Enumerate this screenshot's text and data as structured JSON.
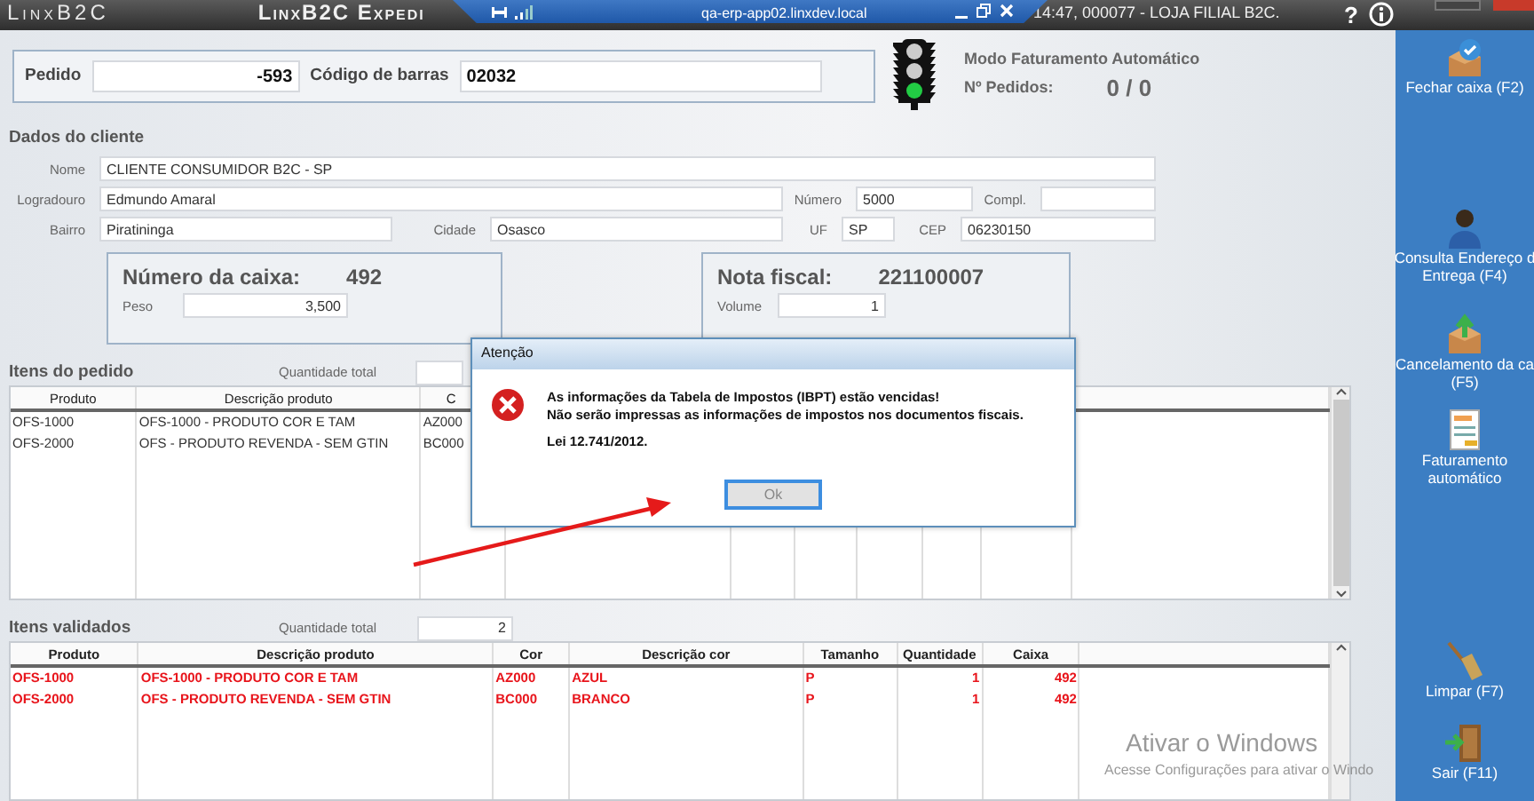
{
  "title_bar": {
    "app_name": "LinxB2C",
    "window_title": "LinxB2C Expedi",
    "session_info": "14:47, 000077 - LOJA FILIAL B2C.",
    "help": "?"
  },
  "remote_bar": {
    "host": "qa-erp-app02.linxdev.local"
  },
  "order": {
    "fields": [
      {
        "label": "Pedido",
        "value": "-593"
      },
      {
        "label": "Código de barras",
        "value": "02032"
      }
    ]
  },
  "status": {
    "mode_label": "Modo Faturamento Automático",
    "orders_label": "Nº Pedidos:",
    "orders_value": "0 / 0"
  },
  "customer": {
    "title": "Dados do cliente",
    "rows": [
      {
        "fields": [
          {
            "label": "Nome",
            "value": "CLIENTE CONSUMIDOR B2C - SP"
          }
        ]
      },
      {
        "fields": [
          {
            "label": "Logradouro",
            "value": "Edmundo Amaral"
          },
          {
            "label": "Número",
            "value": "5000"
          },
          {
            "label": "Compl."
          }
        ]
      },
      {
        "fields": [
          {
            "label": "Bairro",
            "value": "Piratininga"
          },
          {
            "label": "Cidade",
            "value": "Osasco"
          },
          {
            "label": "UF",
            "value": "SP"
          },
          {
            "label": "CEP",
            "value": "06230150"
          }
        ]
      }
    ]
  },
  "box": {
    "title": "Número da caixa:",
    "number": "492",
    "field": {
      "label": "Peso",
      "value": "3,500"
    }
  },
  "invoice": {
    "title": "Nota fiscal:",
    "number": "221100007",
    "field": {
      "label": "Volume",
      "value": "1"
    }
  },
  "order_items": {
    "title": "Itens do pedido",
    "total_label": "Quantidade total",
    "columns": [
      "Produto",
      "Descrição produto",
      "C"
    ],
    "rows": [
      {
        "cells": [
          "OFS-1000",
          "OFS-1000 - PRODUTO COR E TAM",
          "AZ000"
        ],
        "highlighted": false
      },
      {
        "cells": [
          "OFS-2000",
          "OFS - PRODUTO REVENDA - SEM GTIN",
          "BC000"
        ],
        "highlighted": false
      }
    ]
  },
  "validated_items": {
    "title": "Itens validados",
    "total_label": "Quantidade total",
    "total_value": "2",
    "columns": [
      "Produto",
      "Descrição produto",
      "Cor",
      "Descrição cor",
      "Tamanho",
      "Quantidade",
      "Caixa"
    ],
    "rows": [
      {
        "cells": [
          "OFS-1000",
          "OFS-1000 - PRODUTO COR E TAM",
          "AZ000",
          "AZUL",
          "P",
          "1",
          "492"
        ],
        "highlighted": true
      },
      {
        "cells": [
          "OFS-2000",
          "OFS - PRODUTO REVENDA - SEM GTIN",
          "BC000",
          "BRANCO",
          "P",
          "1",
          "492"
        ],
        "highlighted": true
      }
    ]
  },
  "dialog": {
    "title": "Atenção",
    "lines": [
      "As informações da Tabela de Impostos (IBPT) estão vencidas!",
      "Não serão impressas as informações de impostos nos documentos fiscais."
    ],
    "note": "Lei 12.741/2012.",
    "button": "Ok"
  },
  "sidebar": {
    "items": [
      {
        "kind": "close-register",
        "lines": [
          "Fechar caixa (F2)"
        ]
      },
      {
        "kind": "address",
        "lines": [
          "Consulta Endereço d",
          "Entrega (F4)"
        ]
      },
      {
        "kind": "cancel-box",
        "lines": [
          "Cancelamento da ca",
          "(F5)"
        ]
      },
      {
        "kind": "invoice",
        "lines": [
          "Faturamento",
          "automático"
        ]
      },
      {
        "kind": "clear",
        "lines": [
          "Limpar (F7)"
        ]
      },
      {
        "kind": "exit",
        "lines": [
          "Sair (F11)"
        ]
      }
    ]
  },
  "windows_notice": {
    "title": "Ativar o Windows",
    "text": "Acesse Configurações para ativar o Windo"
  }
}
